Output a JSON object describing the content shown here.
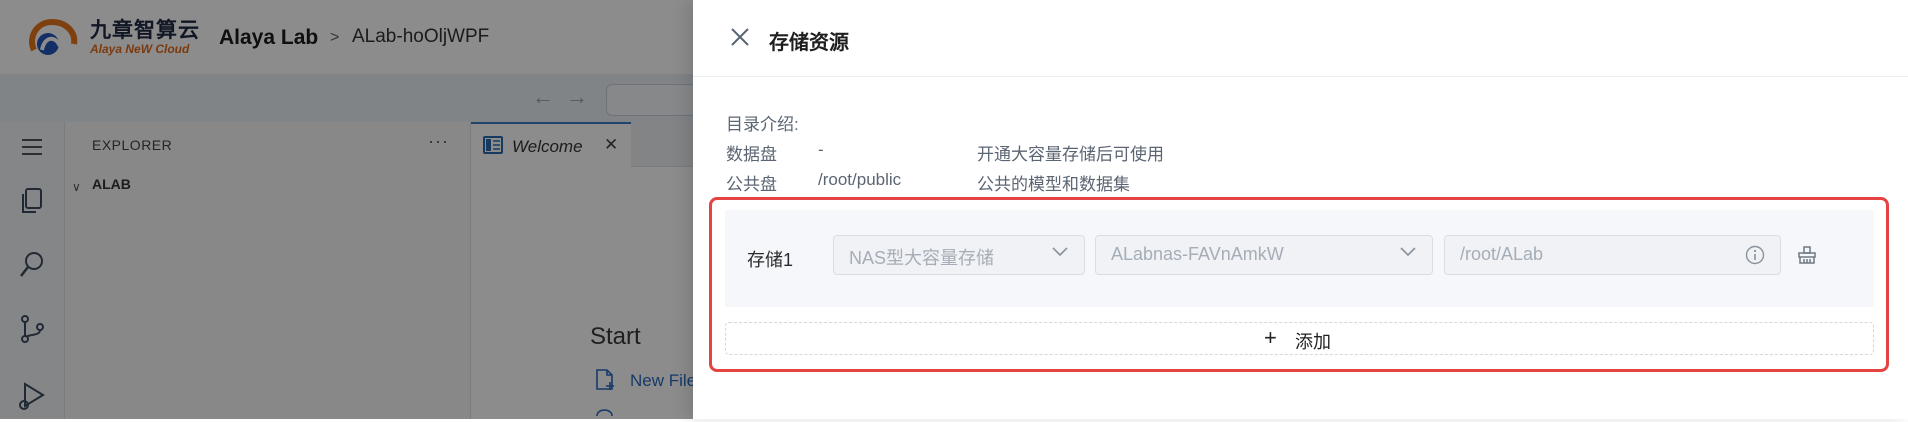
{
  "app": {
    "logo_cn": "九章智算云",
    "logo_en": "Alaya NeW Cloud",
    "title": "Alaya Lab",
    "breadcrumb_sep": ">",
    "instance": "ALab-hoOljWPF"
  },
  "ide": {
    "explorer_title": "EXPLORER",
    "explorer_more": "···",
    "folder": "ALAB",
    "tab_label": "Welcome",
    "start_title": "Start",
    "start_items": [
      "New File..."
    ]
  },
  "drawer": {
    "title": "存储资源",
    "intro": {
      "heading": "目录介绍:",
      "rows": [
        {
          "name": "数据盘",
          "path": "-",
          "desc": "开通大容量存储后可使用"
        },
        {
          "name": "公共盘",
          "path": "/root/public",
          "desc": "公共的模型和数据集"
        }
      ]
    },
    "storage": {
      "label": "存储1",
      "type": "NAS型大容量存储",
      "volume": "ALabnas-FAVnAmkW",
      "mount_path": "/root/ALab"
    },
    "add_label": "添加"
  },
  "colors": {
    "highlight": "#e54242",
    "link": "#2a6bc0",
    "overlay": "rgba(0,0,0,0.45)"
  }
}
